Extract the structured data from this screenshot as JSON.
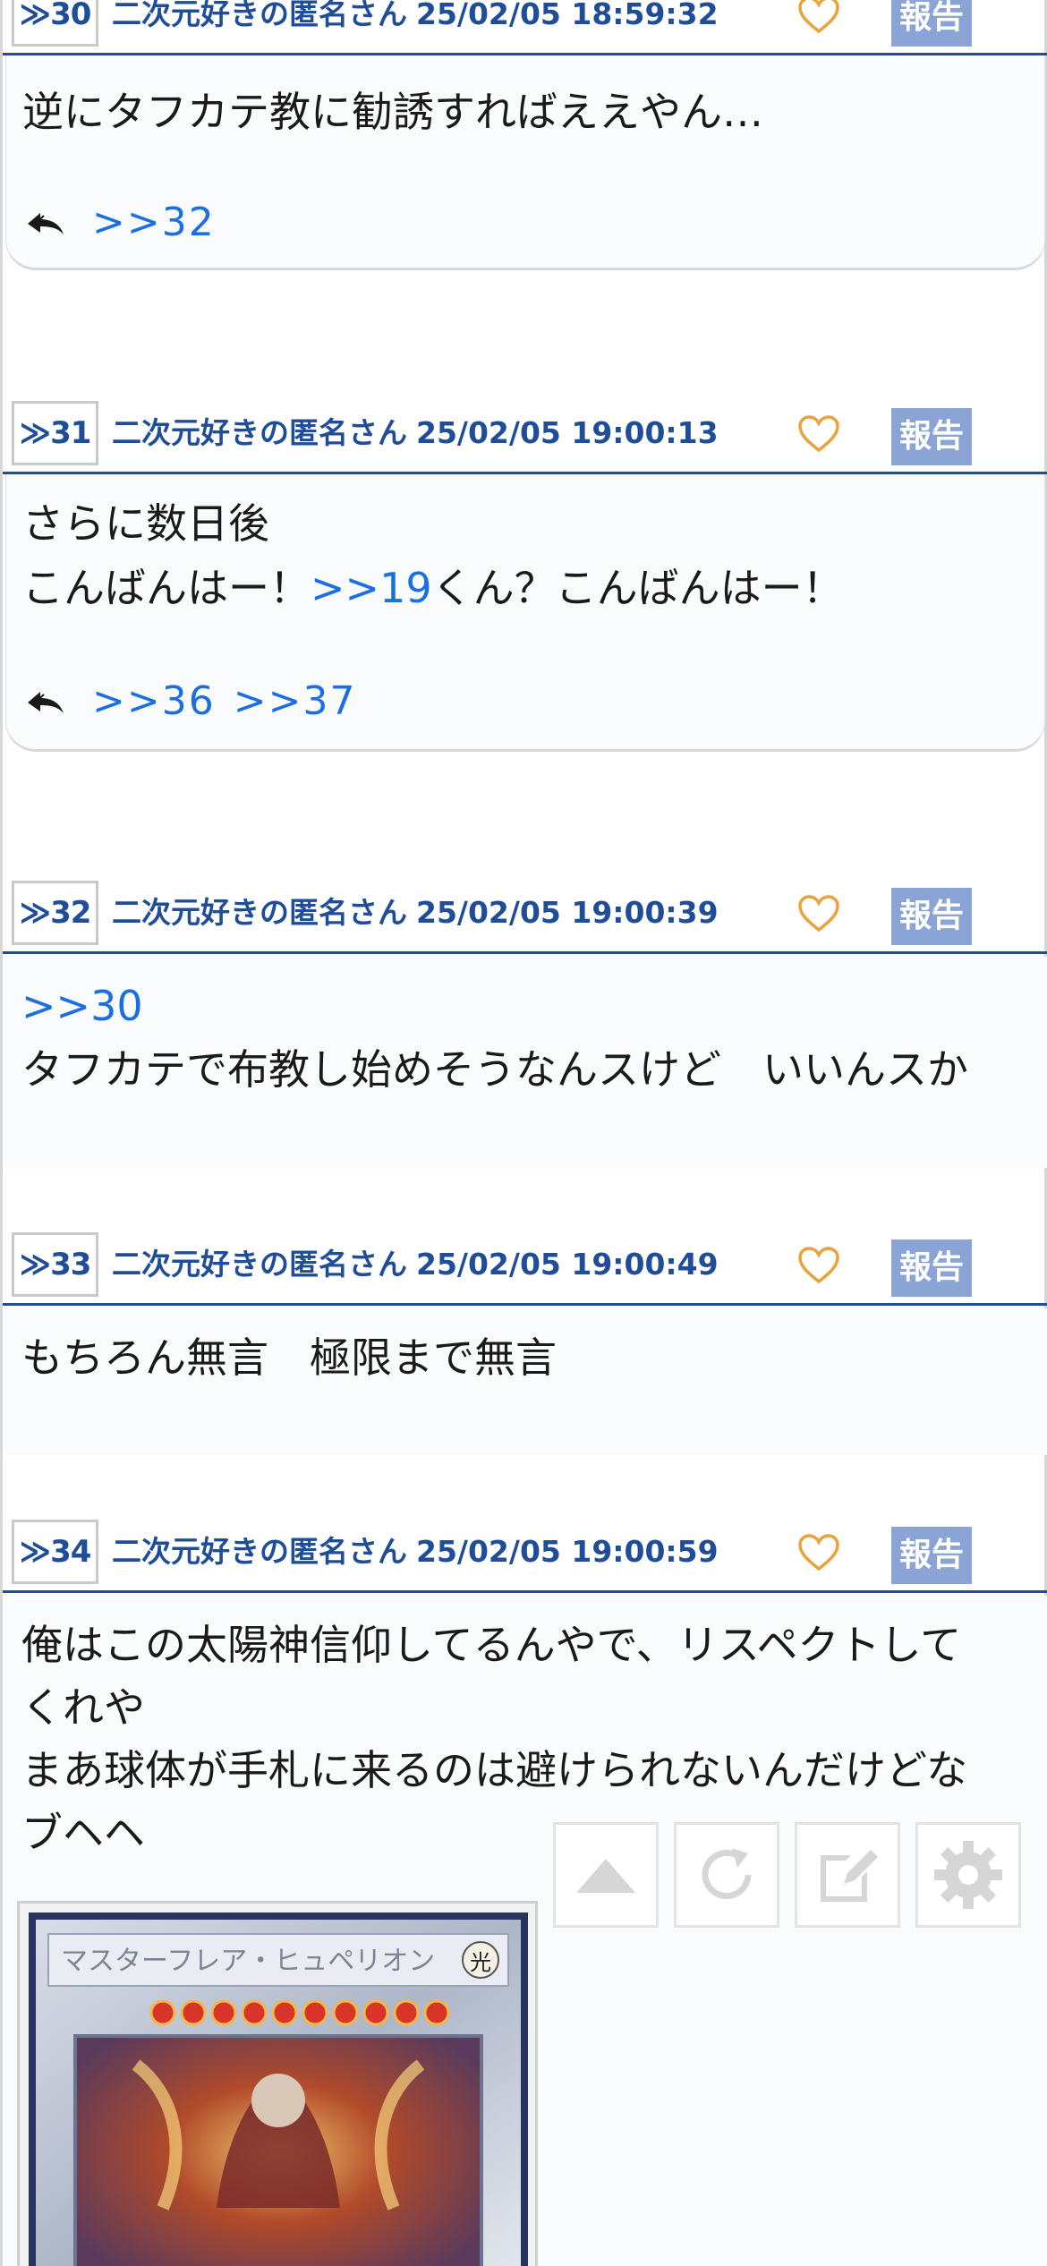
{
  "posts": [
    {
      "num": "30",
      "arrow": "≫",
      "name": "二次元好きの匿名さん",
      "date": "25/02/05 18:59:32",
      "report": "報告",
      "lines": [
        "逆にタフカテ教に勧誘すればええやん…"
      ],
      "replies": [
        ">>32"
      ]
    },
    {
      "num": "31",
      "arrow": "≫",
      "name": "二次元好きの匿名さん",
      "date": "25/02/05 19:00:13",
      "report": "報告",
      "line1": "さらに数日後",
      "line2_pre": "こんばんはー！",
      "line2_anchor": ">>19",
      "line2_post": "くん？こんばんはー！",
      "replies": [
        ">>36",
        ">>37"
      ]
    },
    {
      "num": "32",
      "arrow": "≫",
      "name": "二次元好きの匿名さん",
      "date": "25/02/05 19:00:39",
      "report": "報告",
      "anchor": ">>30",
      "line": "タフカテで布教し始めそうなんスけど　いいんスか"
    },
    {
      "num": "33",
      "arrow": "≫",
      "name": "二次元好きの匿名さん",
      "date": "25/02/05 19:00:49",
      "report": "報告",
      "line": "もちろん無言　極限まで無言"
    },
    {
      "num": "34",
      "arrow": "≫",
      "name": "二次元好きの匿名さん",
      "date": "25/02/05 19:00:59",
      "report": "報告",
      "lines": [
        "俺はこの太陽神信仰してるんやで、リスペクトして",
        "くれや",
        "まあ球体が手札に来るのは避けられないんだけどな",
        "ブヘヘ"
      ]
    }
  ],
  "card_title": "マスターフレア・ヒュペリオン",
  "card_attribute": "光",
  "icons": {
    "reply": "reply-arrow-icon",
    "like": "heart-icon",
    "top": "scroll-top-icon",
    "reload": "reload-icon",
    "write": "edit-icon",
    "settings": "gear-icon"
  },
  "colors": {
    "accent": "#1f4d98",
    "link": "#1c6fe0",
    "report_bg": "#8aa4d6",
    "heart": "#e8a33a"
  }
}
